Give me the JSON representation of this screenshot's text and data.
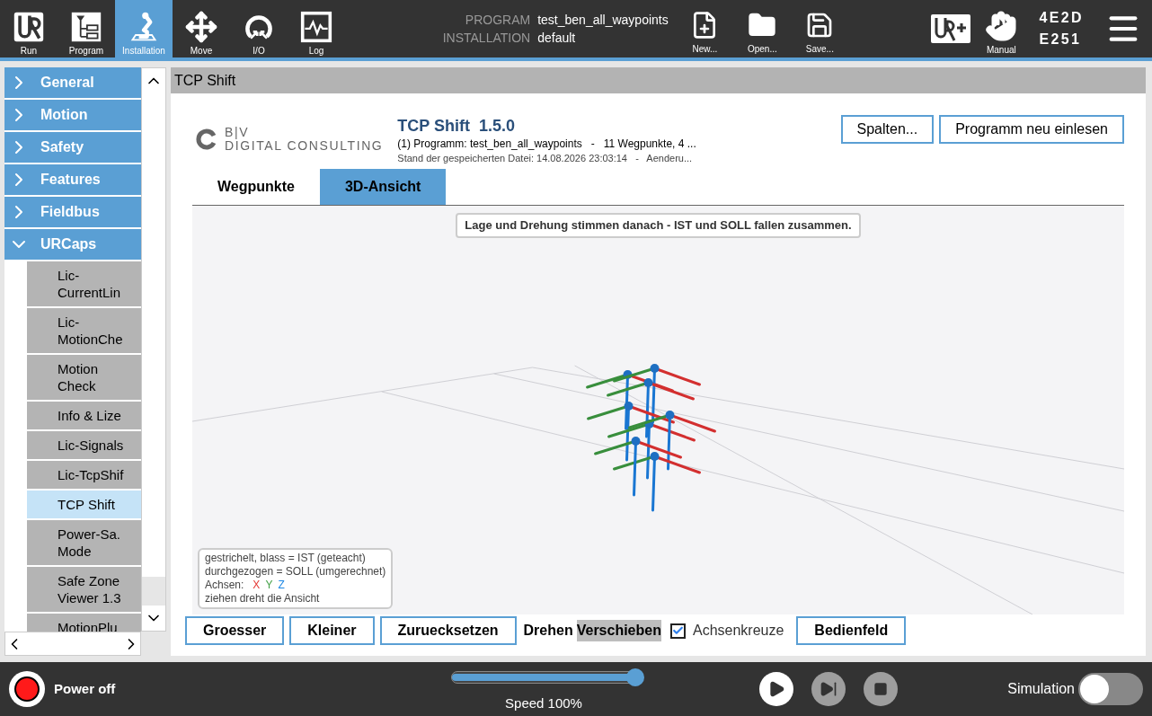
{
  "top_bar": {
    "nav": [
      {
        "kind": "run",
        "label": "Run",
        "selected": false
      },
      {
        "kind": "program",
        "label": "Program",
        "selected": false
      },
      {
        "kind": "installation",
        "label": "Installation",
        "selected": true
      },
      {
        "kind": "move",
        "label": "Move",
        "selected": false
      },
      {
        "kind": "io",
        "label": "I/O",
        "selected": false
      },
      {
        "kind": "log",
        "label": "Log",
        "selected": false
      }
    ],
    "program_label": "PROGRAM",
    "program_name": "test_ben_all_waypoints",
    "installation_label": "INSTALLATION",
    "installation_name": "default",
    "file_actions": [
      {
        "kind": "new",
        "label": "New..."
      },
      {
        "kind": "open",
        "label": "Open..."
      },
      {
        "kind": "save",
        "label": "Save..."
      }
    ],
    "mode_label": "Manual",
    "code_lines": [
      "4E2D",
      "E251"
    ]
  },
  "sidebar": {
    "items": [
      {
        "label": "General",
        "expanded": false,
        "selected": false
      },
      {
        "label": "Motion",
        "expanded": false,
        "selected": false
      },
      {
        "label": "Safety",
        "expanded": false,
        "selected": false
      },
      {
        "label": "Features",
        "expanded": false,
        "selected": false
      },
      {
        "label": "Fieldbus",
        "expanded": false,
        "selected": false
      },
      {
        "label": "URCaps",
        "expanded": true,
        "selected": false,
        "children": [
          {
            "label": "Lic-\nCurrentLin",
            "selected": false
          },
          {
            "label": "Lic-\nMotionChe",
            "selected": false
          },
          {
            "label": "Motion\nCheck",
            "selected": false
          },
          {
            "label": "Info & Lize",
            "selected": false
          },
          {
            "label": "Lic-Signals",
            "selected": false
          },
          {
            "label": "Lic-TcpShif",
            "selected": false
          },
          {
            "label": "TCP Shift",
            "selected": true
          },
          {
            "label": "Power-Sa.\nMode",
            "selected": false
          },
          {
            "label": "Safe Zone\nViewer 1.3",
            "selected": false
          },
          {
            "label": "MotionPlu",
            "selected": false
          }
        ]
      }
    ]
  },
  "panel": {
    "title": "TCP Shift",
    "logo": {
      "line_1": "B|V",
      "line_2": "DIGITAL CONSULTING"
    },
    "plugin_title": "TCP Shift  1.5.0",
    "info_line_1": "(1) Programm: test_ben_all_waypoints   -   11 Wegpunkte, 4 ...",
    "info_line_2": "Stand der gespeicherten Datei: 14.08.2026 23:03:14   -   Aenderu...",
    "buttons": [
      "Spalten...",
      "Programm neu einlesen"
    ],
    "tabs": [
      {
        "label": "Wegpunkte",
        "selected": false
      },
      {
        "label": "3D-Ansicht",
        "selected": true
      }
    ],
    "view": {
      "hint": "Lage und Drehung stimmen danach - IST und SOLL fallen zusammen.",
      "legend": {
        "lines_before": [
          "gestrichelt, blass = IST (geteacht)",
          "durchgezogen = SOLL (umgerechnet)"
        ],
        "axes_label": "Achsen:",
        "axes": [
          {
            "label": "X",
            "color": "#e53935"
          },
          {
            "label": "Y",
            "color": "#43a047"
          },
          {
            "label": "Z",
            "color": "#1e88e5"
          }
        ],
        "line_after": "ziehen dreht die Ansicht"
      }
    },
    "controls": {
      "buttons": [
        "Groesser",
        "Kleiner",
        "Zuruecksetzen"
      ],
      "modes": [
        {
          "label": "Drehen",
          "selected": false
        },
        {
          "label": "Verschieben",
          "selected": true
        }
      ],
      "axes_checkbox": {
        "label": "Achsenkreuze",
        "checked": true
      },
      "panel_button": "Bedienfeld"
    }
  },
  "bottom_bar": {
    "power_label": "Power off",
    "speed": {
      "level": 1,
      "reading": "Speed 100%"
    },
    "playback": [
      {
        "kind": "play",
        "disabled": false
      },
      {
        "kind": "step",
        "disabled": true
      },
      {
        "kind": "stop",
        "disabled": true
      }
    ],
    "simulation": {
      "label": "Simulation",
      "on": false
    }
  }
}
